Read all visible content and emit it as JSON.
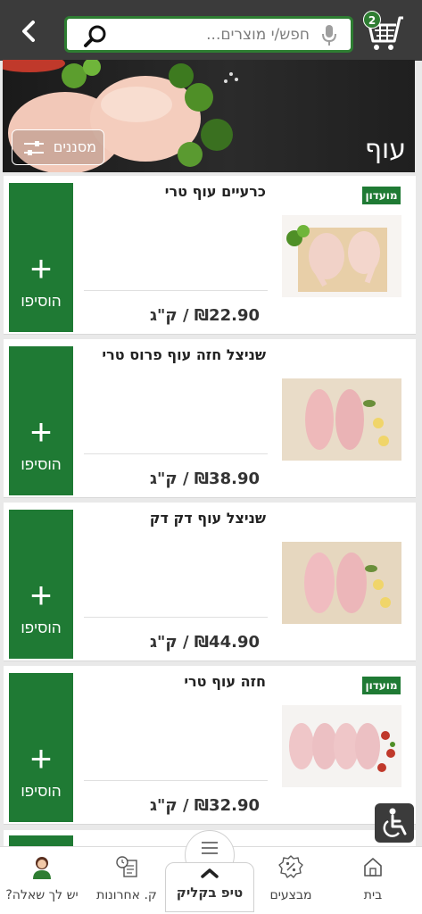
{
  "header": {
    "search_placeholder": "חפש/י מוצרים...",
    "cart_count": "2",
    "back_icon": "chevron-left-icon",
    "accent": "#2e7d32"
  },
  "banner": {
    "title": "עוף",
    "filter_label": "מסננים"
  },
  "products": [
    {
      "name": "כרעיים עוף טרי",
      "price": "₪22.90 / ק\"ג",
      "badge": "מועדון",
      "add_label": "הוסיפו"
    },
    {
      "name": "שניצל חזה עוף פרוס טרי",
      "price": "₪38.90 / ק\"ג",
      "badge": "",
      "add_label": "הוסיפו"
    },
    {
      "name": "שניצל עוף דק דק",
      "price": "₪44.90 / ק\"ג",
      "badge": "",
      "add_label": "הוסיפו"
    },
    {
      "name": "חזה עוף טרי",
      "price": "₪32.90 / ק\"ג",
      "badge": "מועדון",
      "add_label": "הוסיפו"
    }
  ],
  "bottom_nav": {
    "home": "בית",
    "deals": "מבצעים",
    "tip": "טיפ בקליק",
    "recent": "ק. אחרונות",
    "question": "יש לך שאלה?"
  }
}
